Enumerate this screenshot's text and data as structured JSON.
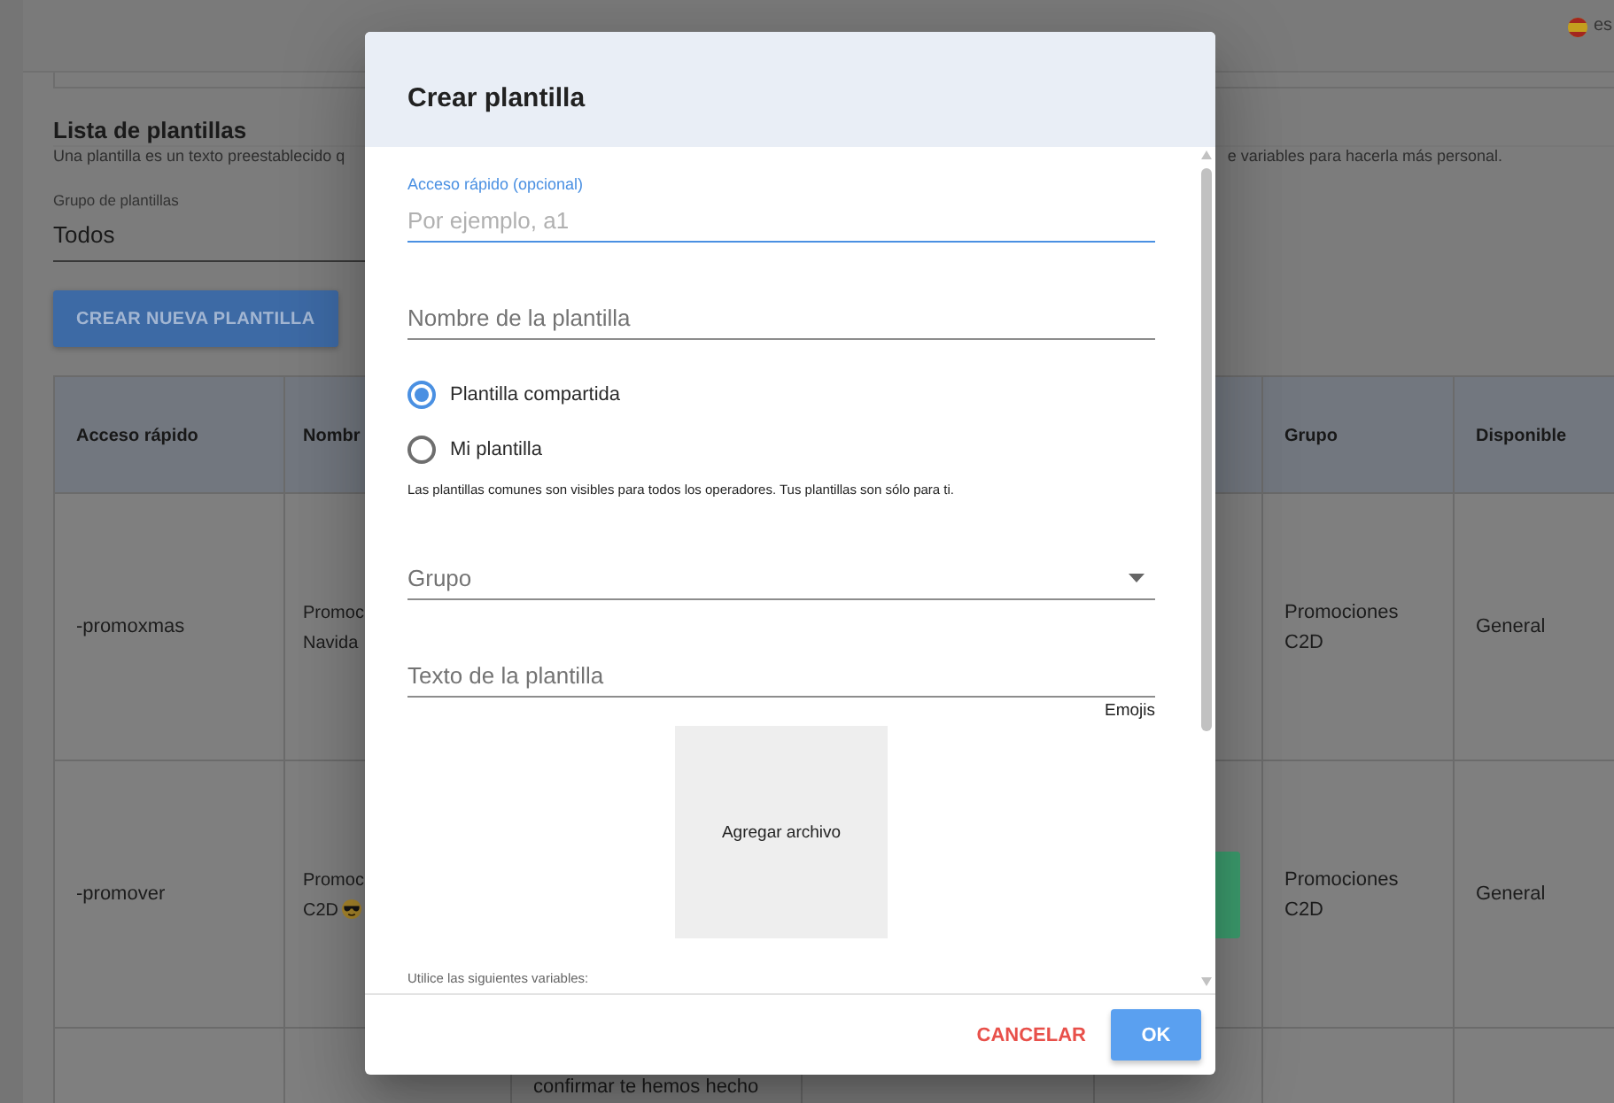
{
  "top_bar": {
    "language": "es"
  },
  "list": {
    "title": "Lista de plantillas",
    "description_start": "Una plantilla es un texto preestablecido q",
    "description_end": "e variables para hacerla más personal.",
    "filter": {
      "label": "Grupo de plantillas",
      "value": "Todos"
    },
    "create_button": "CREAR NUEVA PLANTILLA"
  },
  "table": {
    "columns": [
      "Acceso rápido",
      "Nombr",
      "Grupo",
      "Disponible"
    ],
    "rows": [
      {
        "quick_access": "-promoxmas",
        "name": "Promoc Navida",
        "group": "Promociones C2D",
        "available": "General"
      },
      {
        "quick_access": "-promover",
        "name": "Promoc C2D",
        "name_emoji": true,
        "action_button": true,
        "group": "Promociones C2D",
        "available": "General"
      },
      {
        "column_3": "confirmar te hemos hecho"
      }
    ]
  },
  "dialog": {
    "title": "Crear plantilla",
    "fields": [
      {
        "kind": "text",
        "label": "Acceso rápido (opcional)",
        "placeholder": "Por ejemplo, a1",
        "focused": true
      },
      {
        "kind": "text",
        "placeholder": "Nombre de la plantilla",
        "focused": false
      },
      {
        "kind": "radio",
        "options": [
          {
            "label": "Plantilla compartida",
            "selected": true
          },
          {
            "label": "Mi plantilla",
            "selected": false
          }
        ],
        "hint": "Las plantillas comunes son visibles para todos los operadores. Tus plantillas son sólo para ti."
      },
      {
        "kind": "select",
        "label": "Grupo"
      },
      {
        "kind": "text",
        "placeholder": "Texto de la plantilla",
        "focused": false,
        "link": "Emojis"
      },
      {
        "kind": "upload",
        "label": "Agregar archivo"
      },
      {
        "kind": "note",
        "text": "Utilice las siguientes variables:"
      }
    ],
    "buttons": [
      {
        "kind": "text",
        "label": "CANCELAR"
      },
      {
        "kind": "primary",
        "label": "OK"
      }
    ]
  }
}
